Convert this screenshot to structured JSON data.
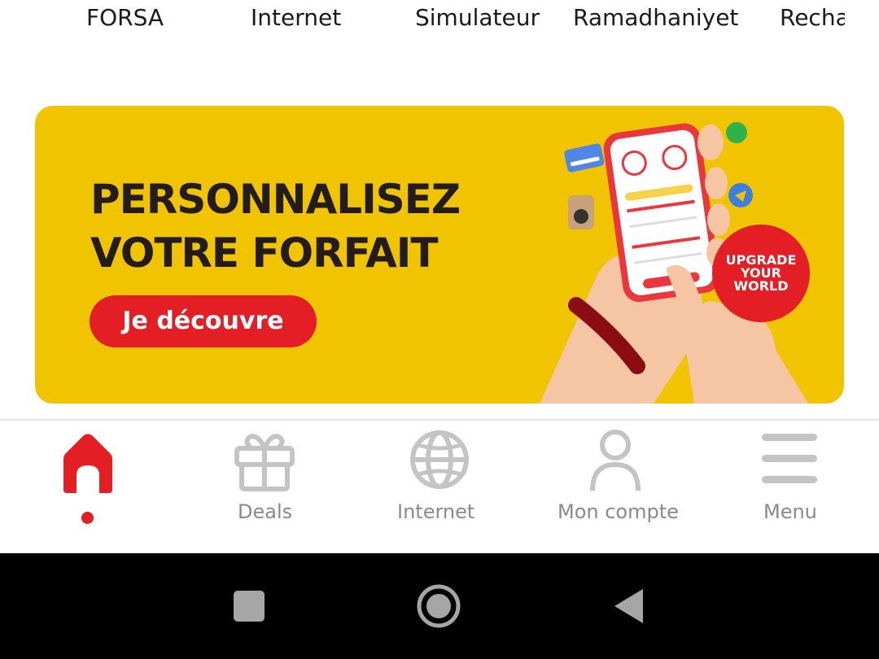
{
  "categories": [
    "FORSA",
    "Internet",
    "Simulateur",
    "Ramadhaniyet",
    "Recharge"
  ],
  "banner": {
    "title_line1": "PERSONNALISEZ",
    "title_line2": "VOTRE FORFAIT",
    "cta_label": "Je découvre",
    "badge_line1": "UPGRADE",
    "badge_line2": "YOUR",
    "badge_line3": "WORLD",
    "colors": {
      "background": "#f0c400",
      "accent": "#e41e25",
      "title": "#231c1a"
    }
  },
  "bottom_nav": {
    "items": [
      {
        "label": "",
        "icon": "home-icon",
        "active": true
      },
      {
        "label": "Deals",
        "icon": "gift-icon",
        "active": false
      },
      {
        "label": "Internet",
        "icon": "globe-icon",
        "active": false
      },
      {
        "label": "Mon compte",
        "icon": "user-icon",
        "active": false
      },
      {
        "label": "Menu",
        "icon": "menu-icon",
        "active": false
      }
    ],
    "colors": {
      "active": "#e41e25",
      "inactive": "#bdbdbd",
      "label": "#8a8a8a"
    }
  },
  "system_nav": {
    "buttons": [
      "recents-button",
      "home-button",
      "back-button"
    ]
  }
}
